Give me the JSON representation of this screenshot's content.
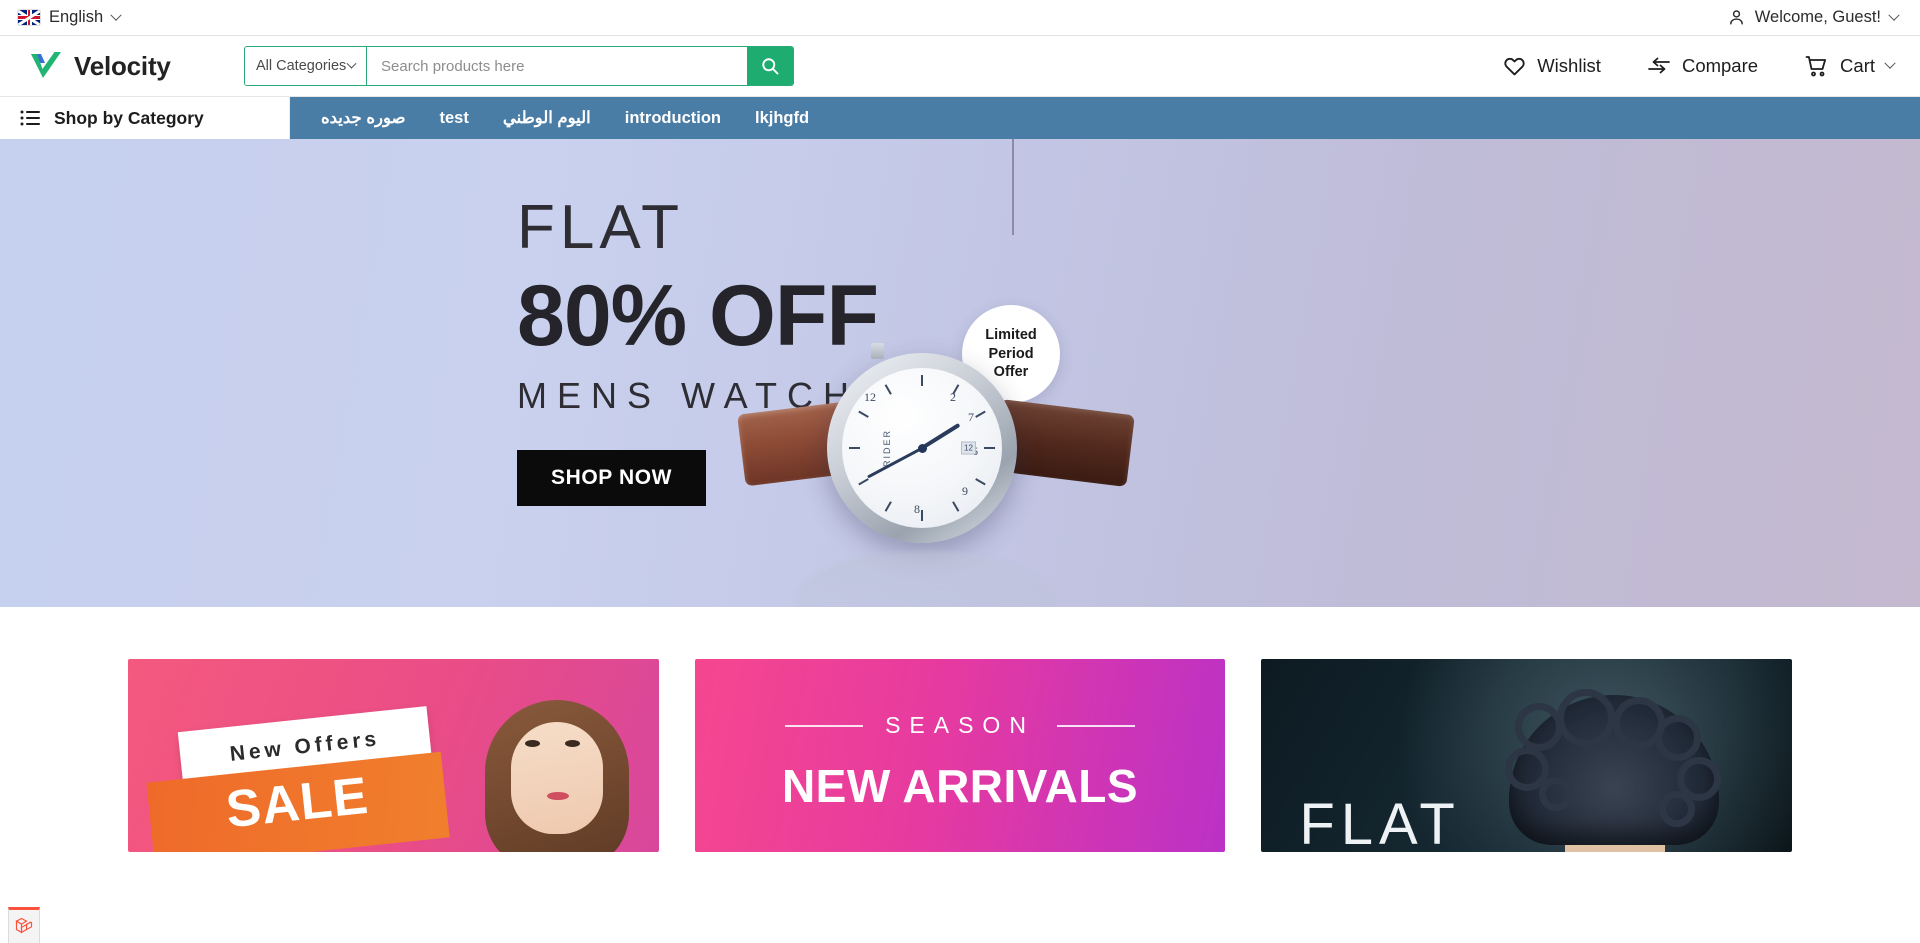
{
  "topbar": {
    "language": "English",
    "language_icon": "uk-flag-icon",
    "language_chevron": "chevron-down-icon",
    "account_icon": "user-icon",
    "welcome": "Welcome, Guest!",
    "account_chevron": "chevron-down-icon"
  },
  "header": {
    "logo_icon": "velocity-check-logo",
    "brand": "Velocity",
    "search": {
      "category_label": "All Categories",
      "category_chevron": "chevron-down-icon",
      "placeholder": "Search products here",
      "value": "",
      "button_icon": "search-icon",
      "accent": "#1eac71"
    },
    "actions": [
      {
        "label": "Wishlist",
        "icon": "heart-icon"
      },
      {
        "label": "Compare",
        "icon": "compare-arrows-icon"
      },
      {
        "label": "Cart",
        "icon": "shopping-cart-icon",
        "chevron": "chevron-down-icon"
      }
    ]
  },
  "nav": {
    "shop_by_category": "Shop by Category",
    "shop_icon": "list-menu-icon",
    "bar_color": "#4a7da6",
    "items": [
      {
        "label": "صوره جديده",
        "rtl": true
      },
      {
        "label": "test",
        "rtl": false
      },
      {
        "label": "اليوم الوطني",
        "rtl": true
      },
      {
        "label": "introduction",
        "rtl": false
      },
      {
        "label": "lkjhgfd",
        "rtl": false
      }
    ]
  },
  "hero": {
    "flat": "FLAT",
    "discount": "80% OFF",
    "category": "MENS WATCHES",
    "cta": "SHOP NOW",
    "badge": {
      "line1": "Limited",
      "line2": "Period",
      "line3": "Offer"
    },
    "watch_brand": "RIDER",
    "watch_date": "12",
    "watch_numbers": [
      "12",
      "2",
      "7",
      "6",
      "9",
      "8"
    ]
  },
  "promos": [
    {
      "name": "new-offers-sale",
      "tag": "New Offers",
      "headline": "SALE",
      "colors": {
        "from": "#f4597f",
        "to": "#d8479c",
        "accent": "#ef6a2a"
      }
    },
    {
      "name": "season-new-arrivals",
      "eyebrow": "SEASON",
      "headline": "NEW ARRIVALS",
      "colors": {
        "from": "#f5478f",
        "to": "#bb31c6"
      }
    },
    {
      "name": "flat-offer-dark",
      "headline": "FLAT",
      "colors": {
        "from": "#0d1a22",
        "to": "#0a1419"
      }
    }
  ],
  "debugbar": {
    "icon": "laravel-debugbar-icon",
    "accent": "#fb503b"
  }
}
